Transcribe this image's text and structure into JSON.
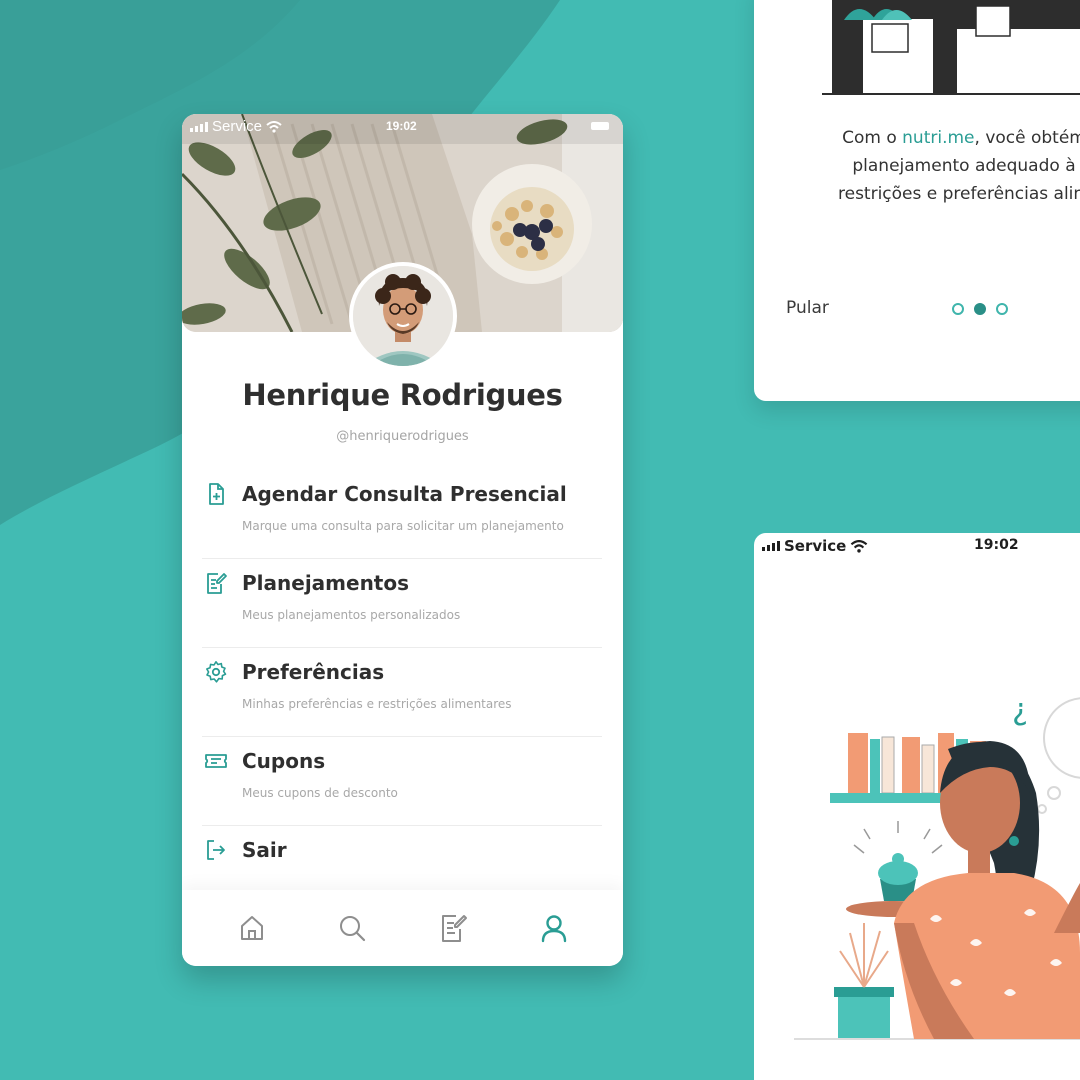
{
  "colors": {
    "accent": "#2a9d94",
    "background": "#41b9b1",
    "text": "#2f2f2f"
  },
  "status_bar": {
    "carrier": "Service",
    "time": "19:02"
  },
  "profile": {
    "name": "Henrique Rodrigues",
    "handle": "@henriquerodrigues"
  },
  "menu": [
    {
      "title": "Agendar Consulta Presencial",
      "subtitle": "Marque uma consulta para solicitar um planejamento",
      "icon": "document-add-icon"
    },
    {
      "title": "Planejamentos",
      "subtitle": "Meus planejamentos personalizados",
      "icon": "edit-document-icon"
    },
    {
      "title": "Preferências",
      "subtitle": "Minhas preferências e restrições alimentares",
      "icon": "gear-icon"
    },
    {
      "title": "Cupons",
      "subtitle": "Meus cupons de desconto",
      "icon": "ticket-icon"
    },
    {
      "title": "Sair",
      "subtitle": "",
      "icon": "logout-icon"
    }
  ],
  "tabbar": [
    {
      "icon": "home-icon",
      "active": false
    },
    {
      "icon": "search-icon",
      "active": false
    },
    {
      "icon": "edit-document-icon",
      "active": false
    },
    {
      "icon": "user-icon",
      "active": true
    }
  ],
  "onboarding": {
    "line1_prefix": "Com o ",
    "brand": "nutri.me",
    "line1_suffix": ", você obtém",
    "line2": "planejamento adequado à",
    "line3": "restrições e preferências alim",
    "skip_label": "Pular",
    "active_dot": 2,
    "dot_count": 3
  },
  "second_phone": {
    "carrier": "Service",
    "time": "19:02"
  }
}
